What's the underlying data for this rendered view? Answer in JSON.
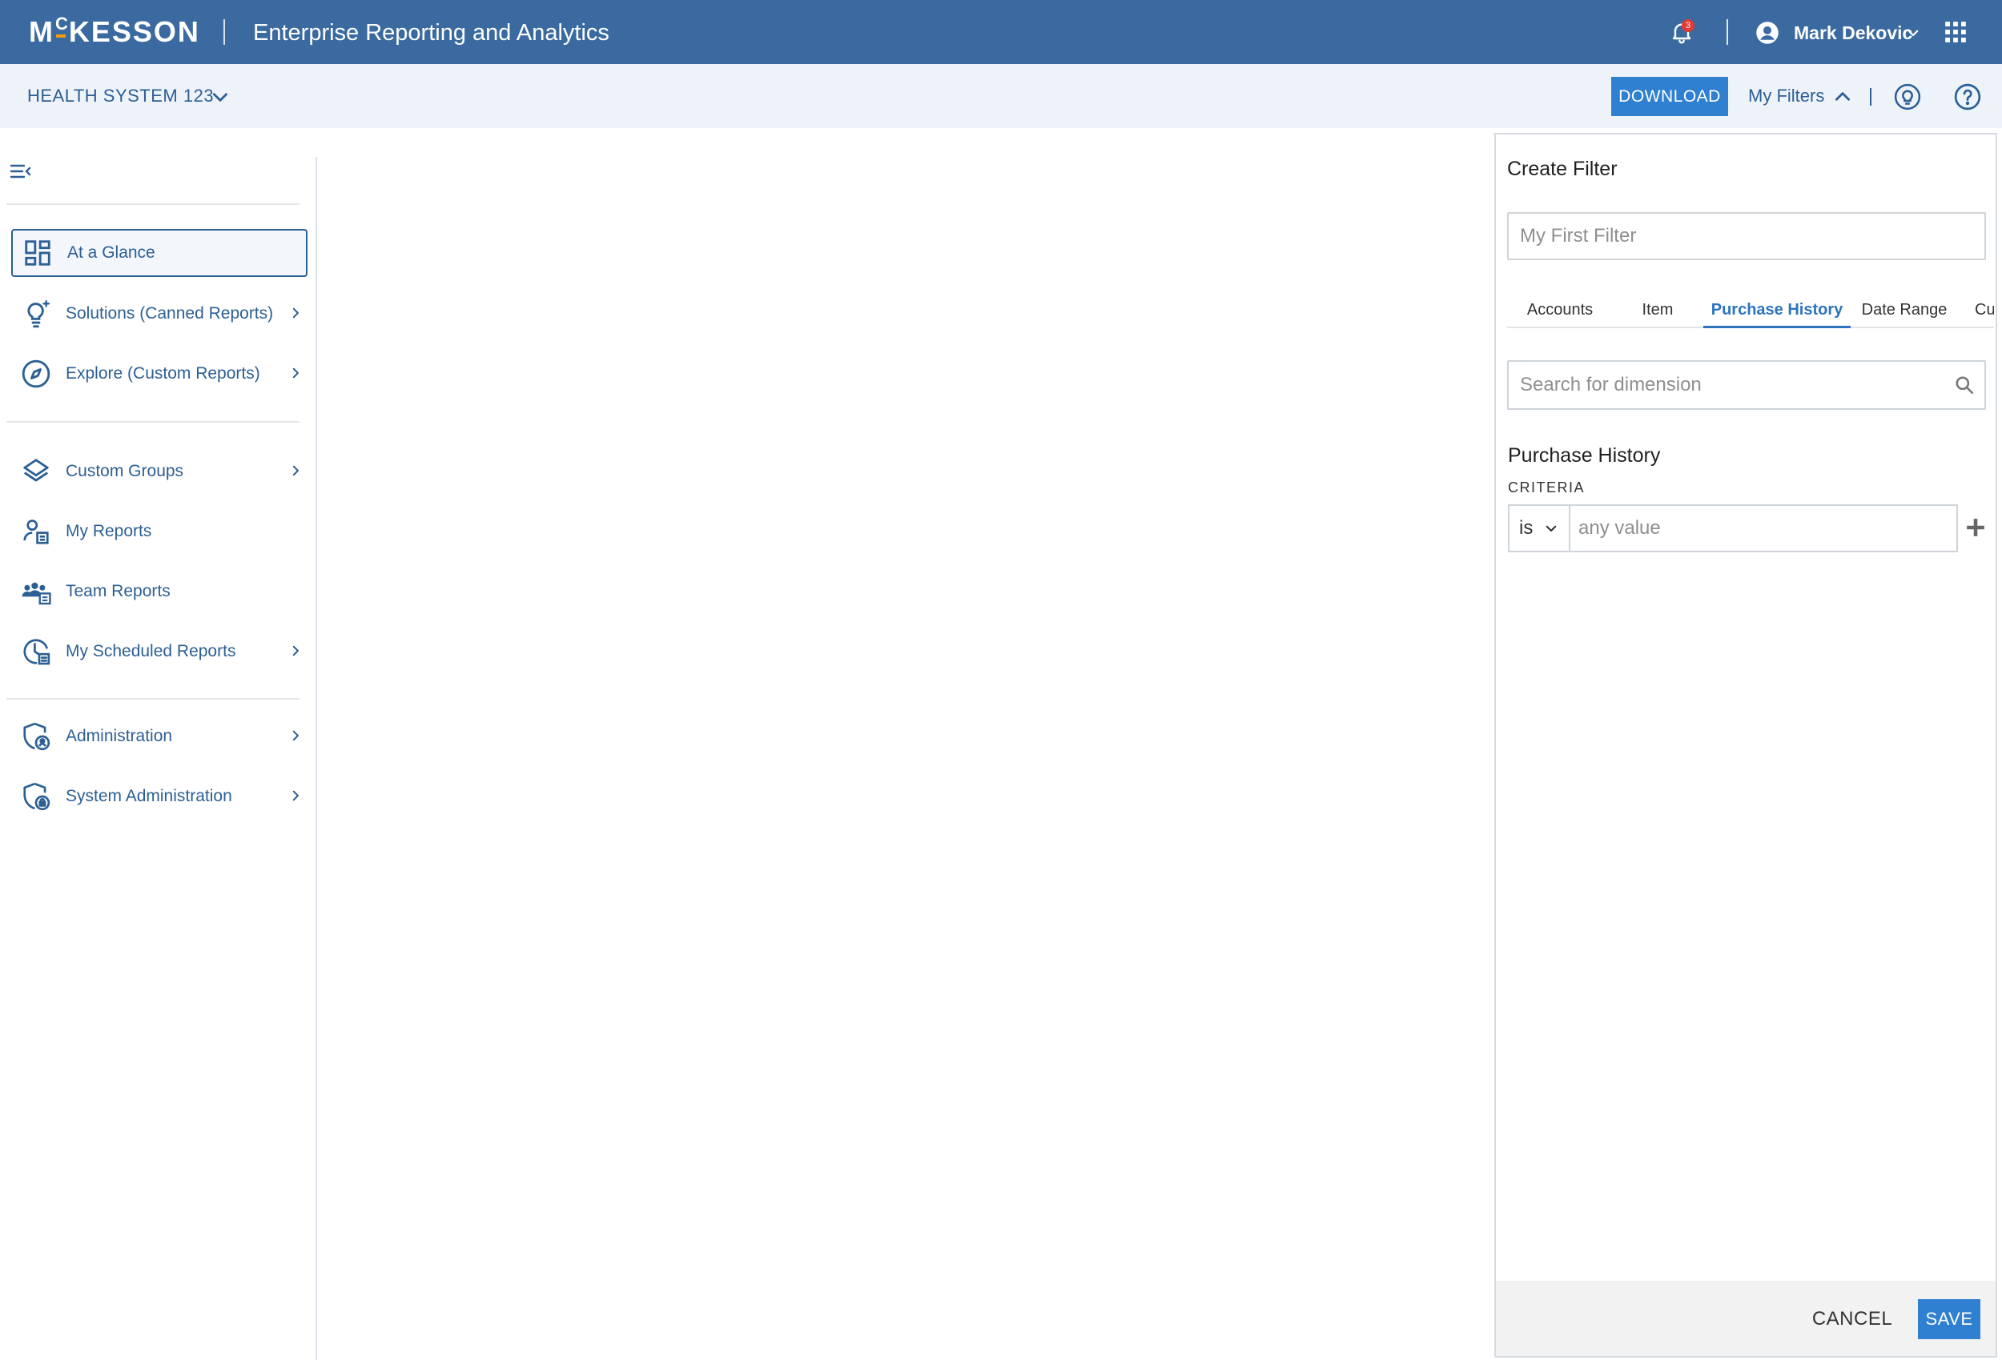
{
  "header": {
    "logo_text": "McKESSON",
    "app_title": "Enterprise Reporting and Analytics",
    "notification_count": "3",
    "user_name": "Mark Dekovic",
    "icons": [
      "bell-icon",
      "user-icon",
      "chevron-down-icon",
      "apps-grid-icon"
    ]
  },
  "subheader": {
    "org_name": "HEALTH SYSTEM 123",
    "download_label": "DOWNLOAD",
    "my_filters_label": "My Filters",
    "icons": [
      "chevron-down-icon",
      "chevron-up-icon",
      "lightbulb-icon",
      "help-icon"
    ]
  },
  "sidebar": {
    "items": [
      {
        "label": "At a Glance",
        "icon": "dashboard-icon",
        "active": true,
        "has_chevron": false
      },
      {
        "label": "Solutions (Canned Reports)",
        "icon": "lightbulb-icon",
        "has_chevron": true
      },
      {
        "label": "Explore (Custom Reports)",
        "icon": "compass-icon",
        "has_chevron": true
      },
      {
        "label": "Custom Groups",
        "icon": "layers-icon",
        "has_chevron": true
      },
      {
        "label": "My Reports",
        "icon": "user-report-icon",
        "has_chevron": false
      },
      {
        "label": "Team Reports",
        "icon": "team-report-icon",
        "has_chevron": false
      },
      {
        "label": "My Scheduled Reports",
        "icon": "clock-report-icon",
        "has_chevron": true
      },
      {
        "label": "Administration",
        "icon": "shield-user-icon",
        "has_chevron": true
      },
      {
        "label": "System Administration",
        "icon": "shield-lock-icon",
        "has_chevron": true
      }
    ]
  },
  "filter_panel": {
    "title": "Create Filter",
    "name_placeholder": "My First Filter",
    "tabs": [
      {
        "label": "Accounts",
        "active": false
      },
      {
        "label": "Item",
        "active": false
      },
      {
        "label": "Purchase History",
        "active": true
      },
      {
        "label": "Date Range",
        "active": false
      },
      {
        "label": "Cu",
        "active": false
      }
    ],
    "search_placeholder": "Search for dimension",
    "section_title": "Purchase History",
    "criteria_label": "CRITERIA",
    "criteria_operator": "is",
    "criteria_value_placeholder": "any value",
    "cancel_label": "CANCEL",
    "save_label": "SAVE"
  },
  "colors": {
    "header_bg": "#3a6aa0",
    "subheader_bg": "#eef3fa",
    "primary_text": "#2c5f94",
    "button_blue": "#2f80d0",
    "active_tab": "#2c74c0",
    "badge_red": "#e53935",
    "logo_accent": "#f39c12"
  }
}
